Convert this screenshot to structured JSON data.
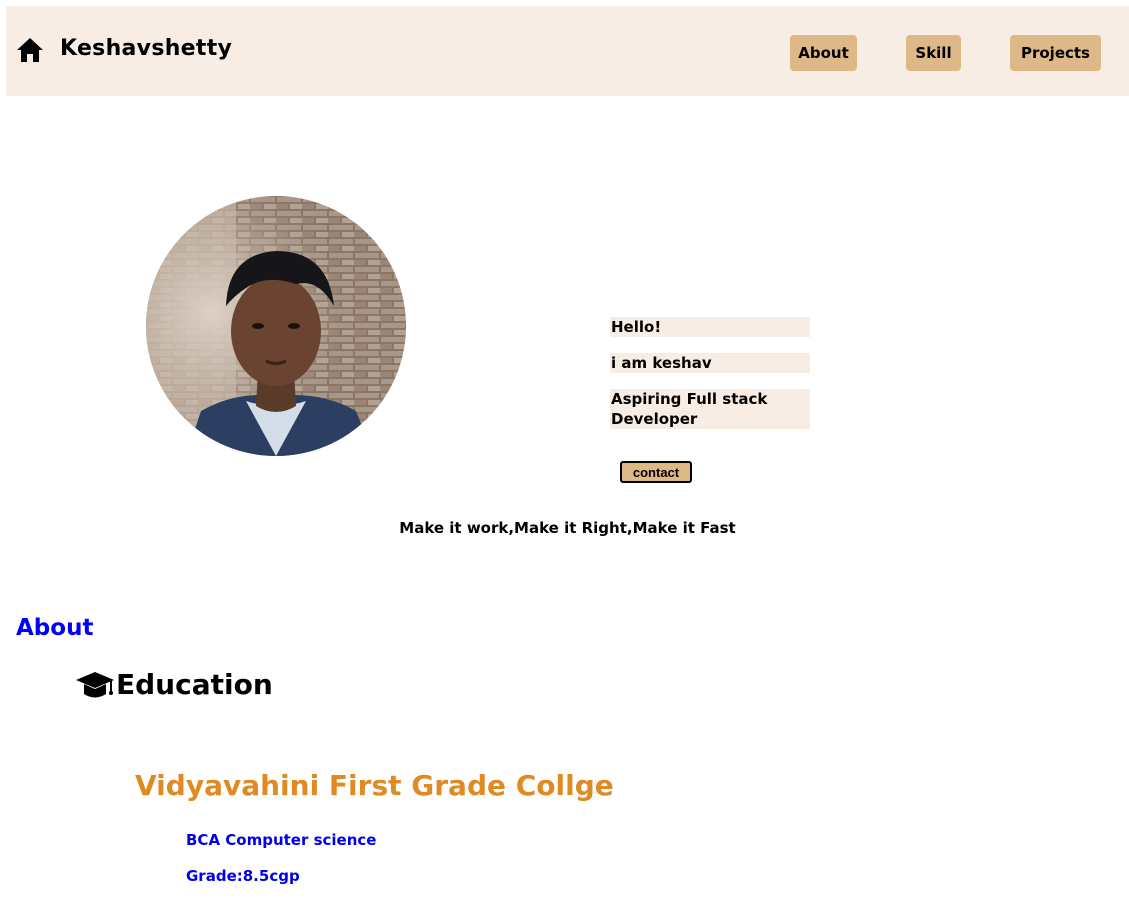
{
  "navbar": {
    "brand": "Keshavshetty",
    "home_icon": "home-icon",
    "links": [
      "About",
      "Skill",
      "Projects"
    ],
    "background": "#f7ede4",
    "button_color": "#deb887"
  },
  "hero": {
    "greeting": "Hello!",
    "name_line": "i am keshav",
    "role_line": "Aspiring Full stack Developer",
    "contact_label": "contact",
    "motto": "Make it work,Make it Right,Make it Fast"
  },
  "about": {
    "heading": "About",
    "heading_color": "#0000ff",
    "education_icon": "graduation-cap-icon",
    "education_heading": "Education",
    "college": "Vidyavahini First Grade Collge",
    "college_color": "#e08a24",
    "course": "BCA Computer science",
    "grade": "Grade:8.5cgp"
  }
}
